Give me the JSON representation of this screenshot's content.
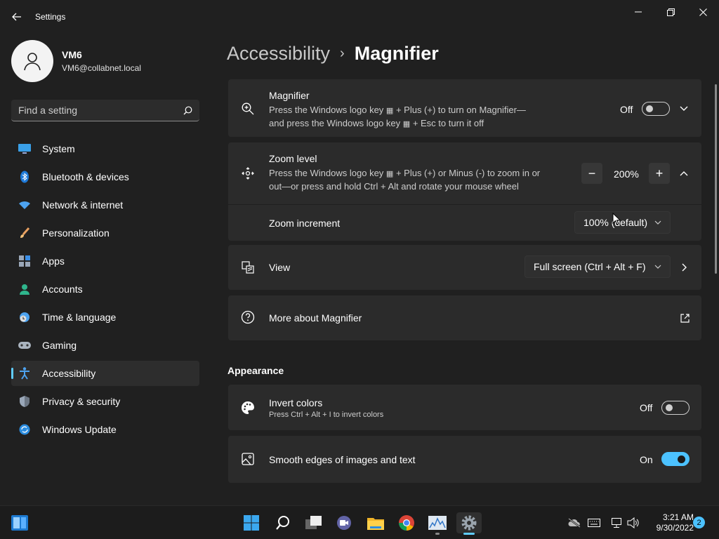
{
  "window": {
    "title": "Settings"
  },
  "profile": {
    "name": "VM6",
    "email": "VM6@collabnet.local"
  },
  "search": {
    "placeholder": "Find a setting"
  },
  "sidebar": {
    "items": [
      {
        "label": "System",
        "icon": "system-icon"
      },
      {
        "label": "Bluetooth & devices",
        "icon": "bluetooth-icon"
      },
      {
        "label": "Network & internet",
        "icon": "network-icon"
      },
      {
        "label": "Personalization",
        "icon": "brush-icon"
      },
      {
        "label": "Apps",
        "icon": "apps-icon"
      },
      {
        "label": "Accounts",
        "icon": "accounts-icon"
      },
      {
        "label": "Time & language",
        "icon": "clock-globe-icon"
      },
      {
        "label": "Gaming",
        "icon": "gamepad-icon"
      },
      {
        "label": "Accessibility",
        "icon": "accessibility-icon",
        "active": true
      },
      {
        "label": "Privacy & security",
        "icon": "shield-icon"
      },
      {
        "label": "Windows Update",
        "icon": "update-icon"
      }
    ]
  },
  "breadcrumb": {
    "parent": "Accessibility",
    "separator": "›",
    "current": "Magnifier"
  },
  "magnifier": {
    "title": "Magnifier",
    "desc_line1": "Press the Windows logo key",
    "desc_line1b": "+ Plus (+) to turn on Magnifier—",
    "desc_line2": "and press the Windows logo key",
    "desc_line2b": "+ Esc to turn it off",
    "state": "Off"
  },
  "zoom": {
    "title": "Zoom level",
    "desc_line1": "Press the Windows logo key",
    "desc_line1b": "+ Plus (+) or Minus (-) to zoom in or",
    "desc_line2": "out—or press and hold Ctrl + Alt and rotate your mouse wheel",
    "value": "200%",
    "minus": "−",
    "plus": "+"
  },
  "zoom_increment": {
    "label": "Zoom increment",
    "value": "100% (default)"
  },
  "view": {
    "label": "View",
    "value": "Full screen (Ctrl + Alt + F)"
  },
  "more": {
    "label": "More about Magnifier"
  },
  "appearance": {
    "heading": "Appearance",
    "invert": {
      "title": "Invert colors",
      "desc": "Press Ctrl + Alt + I to invert colors",
      "state": "Off"
    },
    "smooth": {
      "title": "Smooth edges of images and text",
      "state": "On"
    }
  },
  "taskbar": {
    "time": "3:21 AM",
    "date": "9/30/2022",
    "notifications": "2"
  },
  "colors": {
    "accent": "#4cc2ff",
    "background": "#202020",
    "card": "#2b2b2b"
  }
}
